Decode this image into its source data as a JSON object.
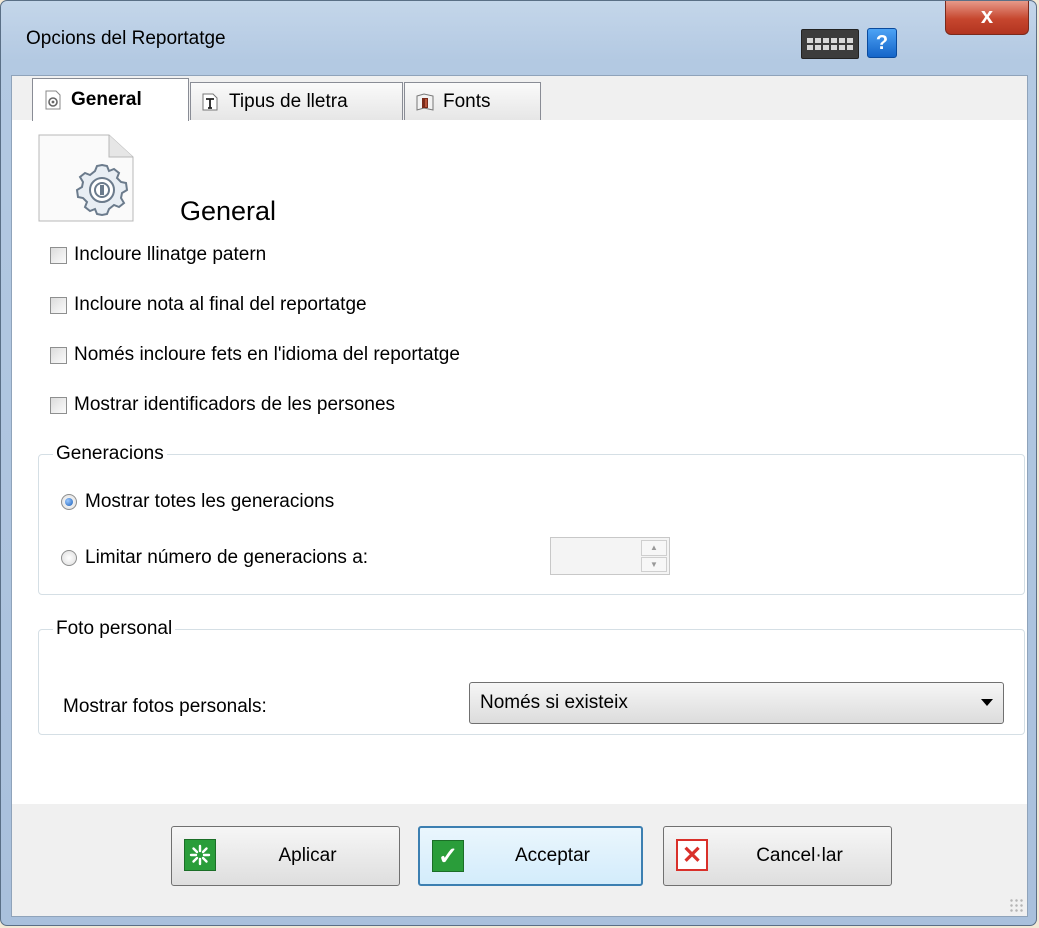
{
  "window": {
    "title": "Opcions del Reportatge",
    "close_glyph": "x",
    "help_glyph": "?",
    "icons": {
      "keyboard": "keyboard-icon",
      "help": "help-icon",
      "close": "close-icon"
    }
  },
  "tabs": [
    {
      "label": "General",
      "icon": "settings-doc-icon",
      "active": true
    },
    {
      "label": "Tipus de lletra",
      "icon": "font-icon",
      "active": false
    },
    {
      "label": "Fonts",
      "icon": "source-icon",
      "active": false
    }
  ],
  "general": {
    "heading": "General",
    "checkboxes": [
      {
        "label": "Incloure llinatge patern",
        "checked": false
      },
      {
        "label": "Incloure nota al final del reportatge",
        "checked": false
      },
      {
        "label": "Només incloure fets en l'idioma del reportatge",
        "checked": false
      },
      {
        "label": "Mostrar identificadors de les persones",
        "checked": false
      }
    ]
  },
  "generations": {
    "legend": "Generacions",
    "options": [
      {
        "label": "Mostrar totes les generacions",
        "selected": true
      },
      {
        "label": "Limitar número de generacions a:",
        "selected": false
      }
    ],
    "limit_value": ""
  },
  "photo": {
    "legend": "Foto personal",
    "label": "Mostrar fotos personals:",
    "selected": "Només si existeix"
  },
  "buttons": {
    "apply": "Aplicar",
    "accept": "Acceptar",
    "cancel": "Cancel·lar",
    "colors": {
      "apply": "#2a9d3a",
      "accept": "#2a9d3a",
      "cancel": "#d9302a",
      "default_border": "#3c7fb1"
    }
  }
}
